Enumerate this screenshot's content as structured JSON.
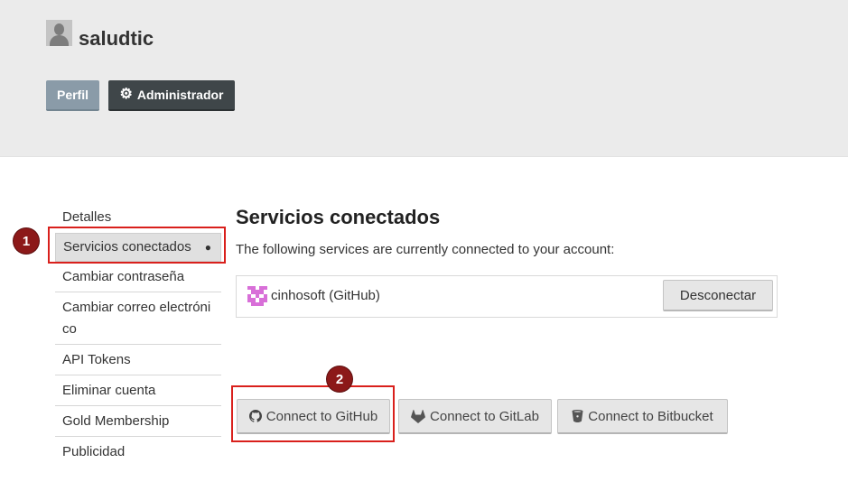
{
  "profile": {
    "username": "saludtic",
    "buttons": {
      "profile_label": "Perfil",
      "admin_label": "Administrador"
    }
  },
  "sidebar": {
    "items": [
      {
        "label": "Detalles"
      },
      {
        "label": "Servicios conectados",
        "active": true,
        "marker": "●"
      },
      {
        "label": "Cambiar contraseña"
      },
      {
        "label": "Cambiar correo electróni co"
      },
      {
        "label": "API Tokens"
      },
      {
        "label": "Eliminar cuenta"
      },
      {
        "label": "Gold Membership"
      },
      {
        "label": "Publicidad"
      }
    ]
  },
  "main": {
    "title": "Servicios conectados",
    "description": "The following services are currently connected to your account:",
    "connected_services": [
      {
        "name": "cinhosoft (GitHub)",
        "icon": "identicon-pink",
        "action_label": "Desconectar"
      }
    ],
    "connect_buttons": [
      {
        "label": "Connect to GitHub",
        "icon": "github-icon"
      },
      {
        "label": "Connect to GitLab",
        "icon": "gitlab-icon"
      },
      {
        "label": "Connect to Bitbucket",
        "icon": "bitbucket-icon"
      }
    ]
  },
  "annotations": [
    {
      "number": "1"
    },
    {
      "number": "2"
    }
  ],
  "colors": {
    "header_bg": "#ebebeb",
    "profile_button": "#8a9ba8",
    "admin_button": "#3f4649",
    "annotation_red": "#d9201c",
    "annotation_badge": "#8c1919",
    "identicon": "#d86fd8"
  }
}
